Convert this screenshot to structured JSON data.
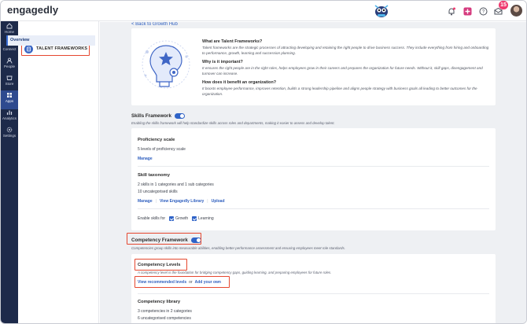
{
  "app": {
    "logo": "engagedly",
    "notification_count": "15"
  },
  "rail": {
    "items": [
      {
        "label": "Home",
        "icon": "home-icon"
      },
      {
        "label": "Connect",
        "icon": "connect-icon"
      },
      {
        "label": "People",
        "icon": "people-icon"
      },
      {
        "label": "Store",
        "icon": "store-icon"
      },
      {
        "label": "Apps",
        "icon": "apps-icon"
      },
      {
        "label": "Analytics",
        "icon": "analytics-icon"
      },
      {
        "label": "Settings",
        "icon": "settings-icon"
      }
    ],
    "active": "Apps"
  },
  "subnav": {
    "header": "TALENT FRAMEWORKS",
    "items": [
      "Overview"
    ]
  },
  "main": {
    "back_link": "< Back to Growth Hub",
    "intro": {
      "q1": "What are Talent Frameworks?",
      "a1": "Talent frameworks are the strategic processes of attracting developing and retaining the right people to drive business success. They include everything from hiring and onboarding to performance, growth, learning and succession planning.",
      "q2": "Why is it important?",
      "a2": "It ensures the right people are in the right roles, helps employees grow in their careers and prepares the organization for future needs. Without it, skill gaps, disengagement and turnover can increase.",
      "q3": "How does it benefit an organization?",
      "a3": "It boosts employee performance, improves retention, builds a strong leadership pipeline and aligns people strategy with business goals all leading to better outcomes for the organization."
    },
    "skills": {
      "title": "Skills Framework",
      "desc": "Enabling the skills framework will help standardize skills across roles and departments, making it easier to assess and develop talent.",
      "proficiency_title": "Proficiency scale",
      "proficiency_line": "5 levels of proficiency scale",
      "manage": "Manage",
      "taxonomy_title": "Skill taxonomy",
      "taxonomy_line1": "2 skills in 1 categories and 1 sub categories",
      "taxonomy_line2": "10 uncategorised skills",
      "view_library": "View Engagedly Library",
      "upload": "Upload",
      "enable_for": "Enable skills for",
      "growth": "Growth",
      "learning": "Learning"
    },
    "competency": {
      "title": "Competency Framework",
      "desc": "Competencies group skills into measurable abilities, enabling better performance assessment and ensuring employees meet role standards.",
      "levels_title": "Competency Levels",
      "levels_desc": "A competency level is the foundation for bridging competency gaps, guiding learning, and preparing employees for future roles.",
      "view_recommended": "View recommended levels",
      "or": "or",
      "add_own": "Add your own",
      "library_title": "Competency library",
      "library_line1": "3 competencies in 2 categories",
      "library_line2": "6 uncategorised competencies"
    }
  }
}
